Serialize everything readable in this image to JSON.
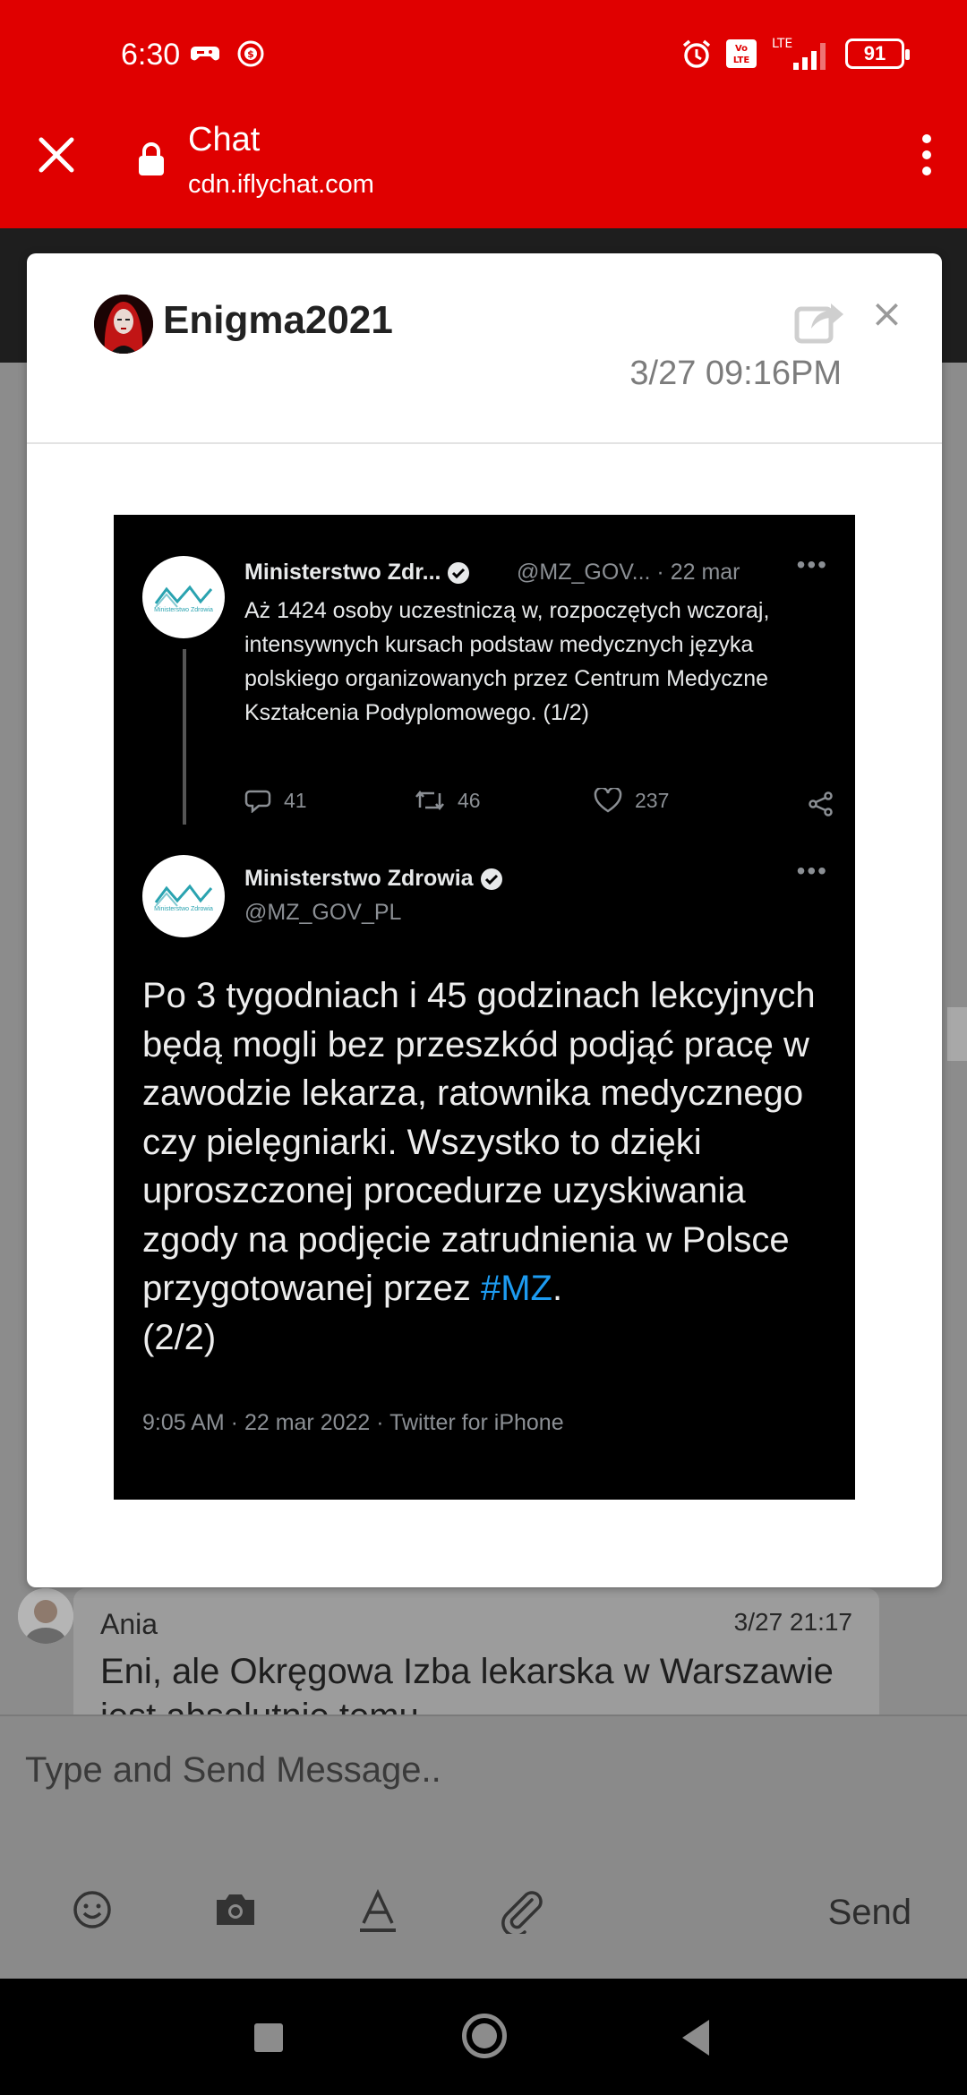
{
  "status_bar": {
    "time": "6:30",
    "battery": "91",
    "network": "LTE"
  },
  "browser": {
    "title": "Chat",
    "host": "cdn.iflychat.com"
  },
  "modal": {
    "username": "Enigma2021",
    "timestamp": "3/27 09:16PM",
    "close_glyph": "×"
  },
  "tweet": {
    "first": {
      "name": "Ministerstwo Zdr...",
      "meta": "@MZ_GOV... · 22 mar",
      "body": "Aż 1424 osoby uczestniczą w, rozpoczętych wczoraj, intensywnych kursach podstaw medycznych języka polskiego organizowanych przez Centrum Medyczne Kształcenia Podyplomowego. (1/2)",
      "replies": "41",
      "retweets": "46",
      "likes": "237"
    },
    "second": {
      "name": "Ministerstwo Zdrowia",
      "handle": "@MZ_GOV_PL",
      "body": "Po 3 tygodniach i 45 godzinach lekcyjnych będą mogli bez przeszkód podjąć pracę w zawodzie lekarza, ratownika medycznego czy pielęgniarki. Wszystko to dzięki uproszczonej procedurze uzyskiwania zgody na podjęcie zatrudnienia w Polsce przygotowanej przez ",
      "hashtag": "#MZ",
      "body_end": ".",
      "counter": "(2/2)",
      "footer": "9:05 AM · 22 mar 2022 · Twitter for iPhone"
    },
    "logo_caption": "Ministerstwo Zdrowia"
  },
  "background_message": {
    "name": "Ania",
    "time": "3/27 21:17",
    "text": "Eni, ale Okręgowa Izba lekarska w Warszawie jest absolutnie temu"
  },
  "composer": {
    "placeholder": "Type and Send Message..",
    "send_label": "Send"
  },
  "colors": {
    "brand_red": "#e00000",
    "link_blue": "#1d9bf0"
  }
}
